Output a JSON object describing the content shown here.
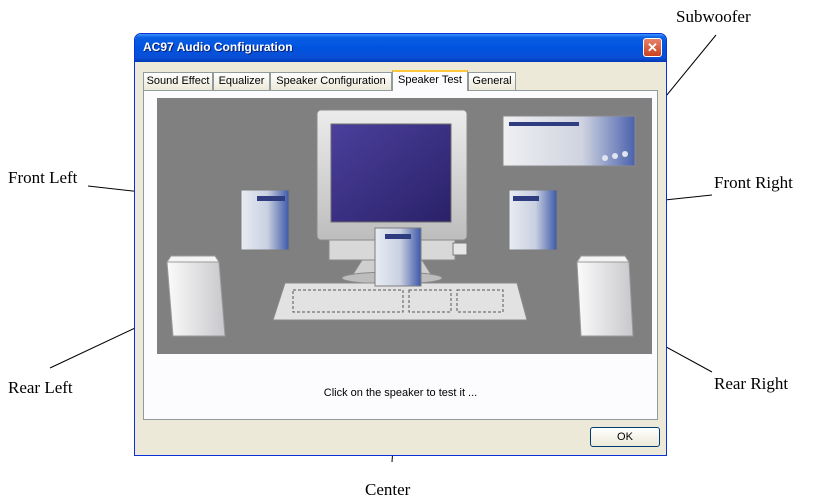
{
  "window": {
    "title": "AC97 Audio Configuration",
    "close_icon": "close-icon"
  },
  "tabs": [
    {
      "label": "Sound Effect"
    },
    {
      "label": "Equalizer"
    },
    {
      "label": "Speaker Configuration"
    },
    {
      "label": "Speaker Test",
      "active": true
    },
    {
      "label": "General"
    }
  ],
  "status_text": "Click on the speaker to test it ...",
  "ok_label": "OK",
  "callouts": {
    "subwoofer": "Subwoofer",
    "front_left": "Front Left",
    "front_right": "Front Right",
    "rear_left": "Rear Left",
    "rear_right": "Rear Right",
    "center": "Center"
  },
  "colors": {
    "title_bar": "#0053e0",
    "stage": "#808080",
    "speaker_blue": "#3d58a8",
    "monitor_screen": "#3a2f86"
  }
}
